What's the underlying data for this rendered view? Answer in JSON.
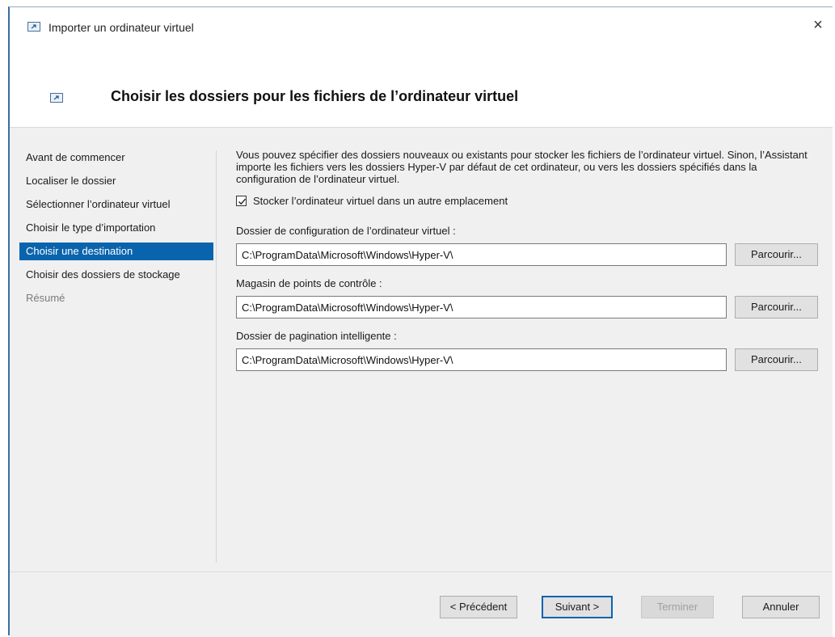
{
  "window": {
    "title": "Importer un ordinateur virtuel",
    "close_glyph": "×"
  },
  "header": {
    "title": "Choisir les dossiers pour les fichiers de l’ordinateur virtuel",
    "icon": "virtual-machine-import-icon"
  },
  "sidebar": {
    "items": [
      {
        "label": "Avant de commencer",
        "state": "normal"
      },
      {
        "label": "Localiser le dossier",
        "state": "normal"
      },
      {
        "label": "Sélectionner l’ordinateur virtuel",
        "state": "normal"
      },
      {
        "label": "Choisir le type d’importation",
        "state": "normal"
      },
      {
        "label": "Choisir une destination",
        "state": "active"
      },
      {
        "label": "Choisir des dossiers de stockage",
        "state": "normal"
      },
      {
        "label": "Résumé",
        "state": "disabled"
      }
    ]
  },
  "main": {
    "description": "Vous pouvez spécifier des dossiers nouveaux ou existants pour stocker les fichiers de l’ordinateur virtuel. Sinon, l’Assistant importe les fichiers vers les dossiers Hyper-V par défaut de cet ordinateur, ou vers les dossiers spécifiés dans la configuration de l’ordinateur virtuel.",
    "checkbox_label": "Stocker l’ordinateur virtuel dans un autre emplacement",
    "checkbox_checked": true,
    "fields": [
      {
        "label": "Dossier de configuration de l’ordinateur virtuel :",
        "value": "C:\\ProgramData\\Microsoft\\Windows\\Hyper-V\\",
        "button": "Parcourir..."
      },
      {
        "label": "Magasin de points de contrôle :",
        "value": "C:\\ProgramData\\Microsoft\\Windows\\Hyper-V\\",
        "button": "Parcourir..."
      },
      {
        "label": "Dossier de pagination intelligente :",
        "value": "C:\\ProgramData\\Microsoft\\Windows\\Hyper-V\\",
        "button": "Parcourir..."
      }
    ]
  },
  "footer": {
    "previous_label": "< Précédent",
    "next_label": "Suivant >",
    "finish_label": "Terminer",
    "cancel_label": "Annuler"
  },
  "colors": {
    "accent": "#0a64ad",
    "window_bg": "#f0f0f0",
    "header_bg": "#ffffff"
  }
}
